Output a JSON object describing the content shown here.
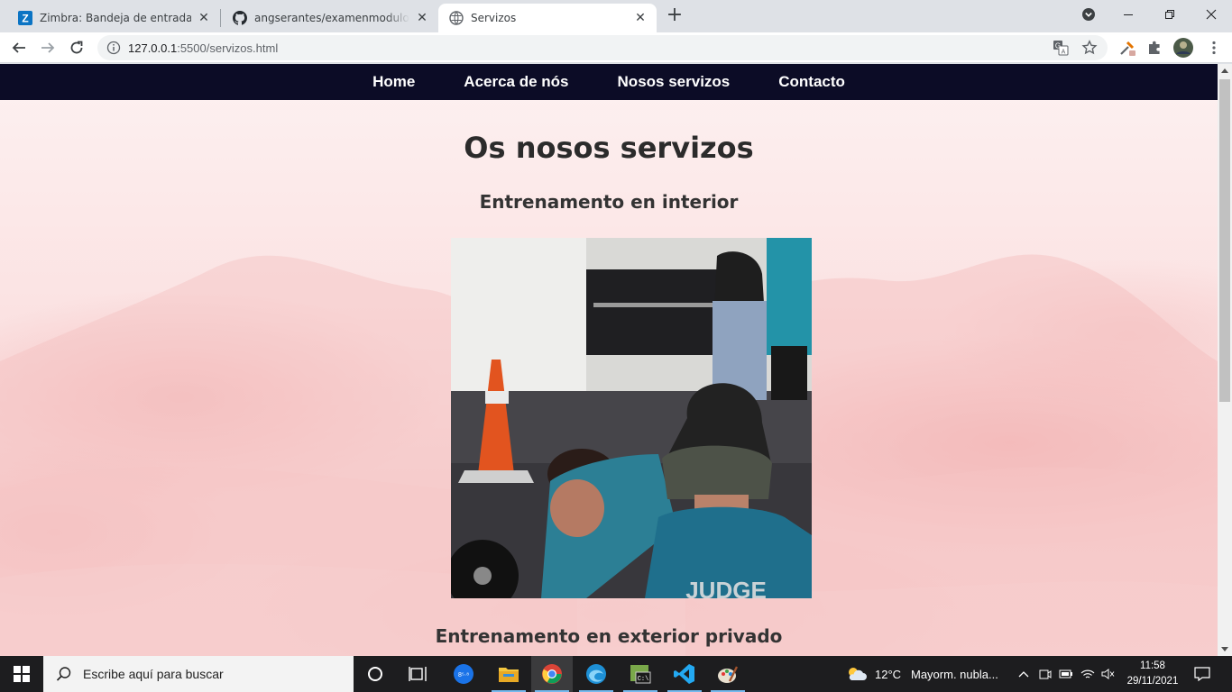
{
  "browser": {
    "tabs": [
      {
        "title": "Zimbra: Bandeja de entrada",
        "favicon": "zimbra-icon",
        "active": false
      },
      {
        "title": "angserantes/examenmoduloangel",
        "favicon": "github-icon",
        "active": false
      },
      {
        "title": "Servizos",
        "favicon": "globe-icon",
        "active": true
      }
    ],
    "close_glyph": "✕",
    "newtab_glyph": "+",
    "url": {
      "host": "127.0.0.1",
      "rest": ":5500/servizos.html"
    },
    "accent": "#dee1e6"
  },
  "page": {
    "nav": [
      "Home",
      "Acerca de nós",
      "Nosos servizos",
      "Contacto"
    ],
    "title": "Os nosos servizos",
    "sections": [
      {
        "heading": "Entrenamento en interior"
      },
      {
        "heading": "Entrenamento en exterior privado"
      }
    ],
    "photo_text": "JUDGE",
    "colors": {
      "nav_bg": "#0c0c26",
      "bg": "#fbe3e3"
    }
  },
  "taskbar": {
    "search_placeholder": "Escribe aquí para buscar",
    "weather": {
      "temp": "12°C",
      "desc": "Mayorm. nubla..."
    },
    "time": "11:58",
    "date": "29/11/2021"
  }
}
